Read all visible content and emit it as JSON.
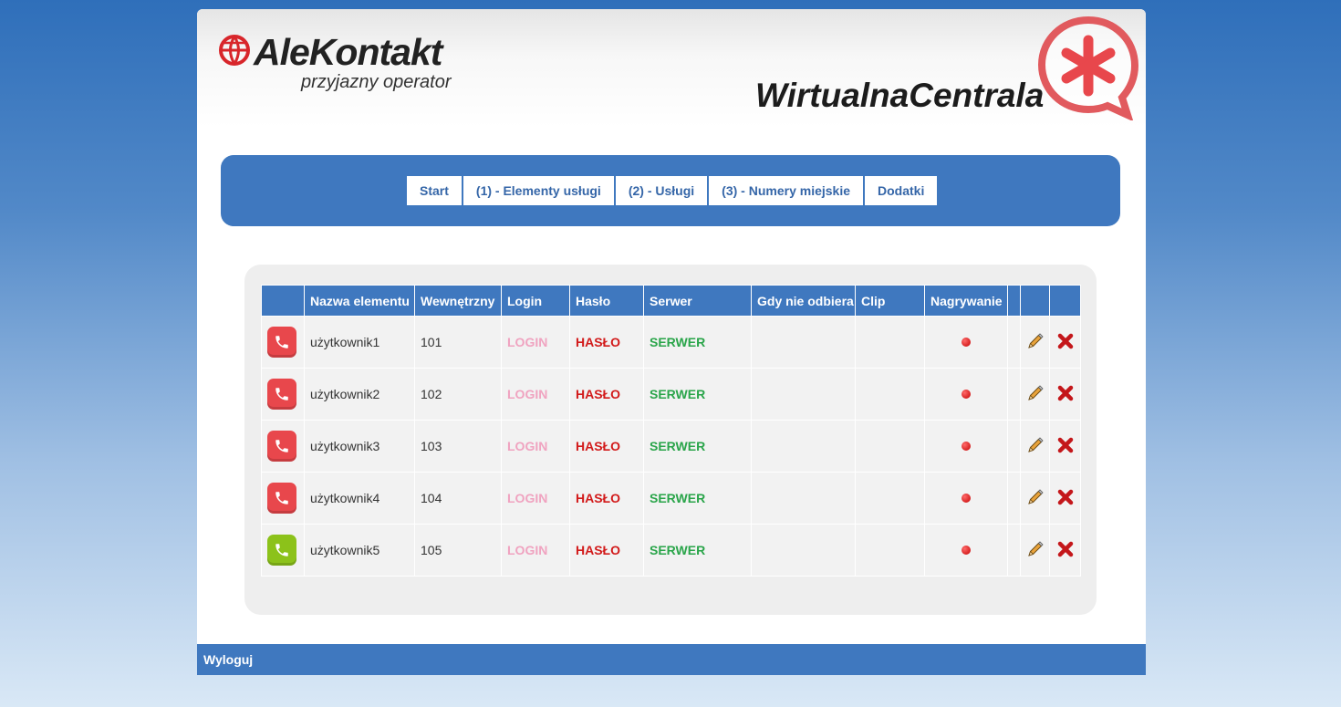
{
  "header": {
    "logo_name": "AleKontakt",
    "logo_tagline": "przyjazny operator",
    "brand_title": "WirtualnaCentrala"
  },
  "nav": {
    "items": [
      "Start",
      "(1) - Elementy usługi",
      "(2) - Usługi",
      "(3) - Numery miejskie",
      "Dodatki"
    ]
  },
  "table": {
    "headers": [
      "",
      "Nazwa elementu",
      "Wewnętrzny",
      "Login",
      "Hasło",
      "Serwer",
      "Gdy nie odbiera",
      "Clip",
      "Nagrywanie",
      "",
      "",
      ""
    ],
    "rows": [
      {
        "status": "red",
        "name": "użytkownik1",
        "ext": "101",
        "login": "LOGIN",
        "password": "HASŁO",
        "server": "SERWER"
      },
      {
        "status": "red",
        "name": "użytkownik2",
        "ext": "102",
        "login": "LOGIN",
        "password": "HASŁO",
        "server": "SERWER"
      },
      {
        "status": "red",
        "name": "użytkownik3",
        "ext": "103",
        "login": "LOGIN",
        "password": "HASŁO",
        "server": "SERWER"
      },
      {
        "status": "red",
        "name": "użytkownik4",
        "ext": "104",
        "login": "LOGIN",
        "password": "HASŁO",
        "server": "SERWER"
      },
      {
        "status": "green",
        "name": "użytkownik5",
        "ext": "105",
        "login": "LOGIN",
        "password": "HASŁO",
        "server": "SERWER"
      }
    ]
  },
  "footer": {
    "logout_label": "Wyloguj"
  },
  "colors": {
    "accent": "#3f78bf",
    "status_red": "#e8474c",
    "status_green": "#8cc21a",
    "login_text": "#f0a3c0",
    "password_text": "#d21a1a",
    "server_text": "#2aa54a"
  },
  "icons": {
    "row_status": "phone-icon",
    "recording": "recording-dot-icon",
    "edit": "pencil-icon",
    "delete": "delete-x-icon"
  }
}
